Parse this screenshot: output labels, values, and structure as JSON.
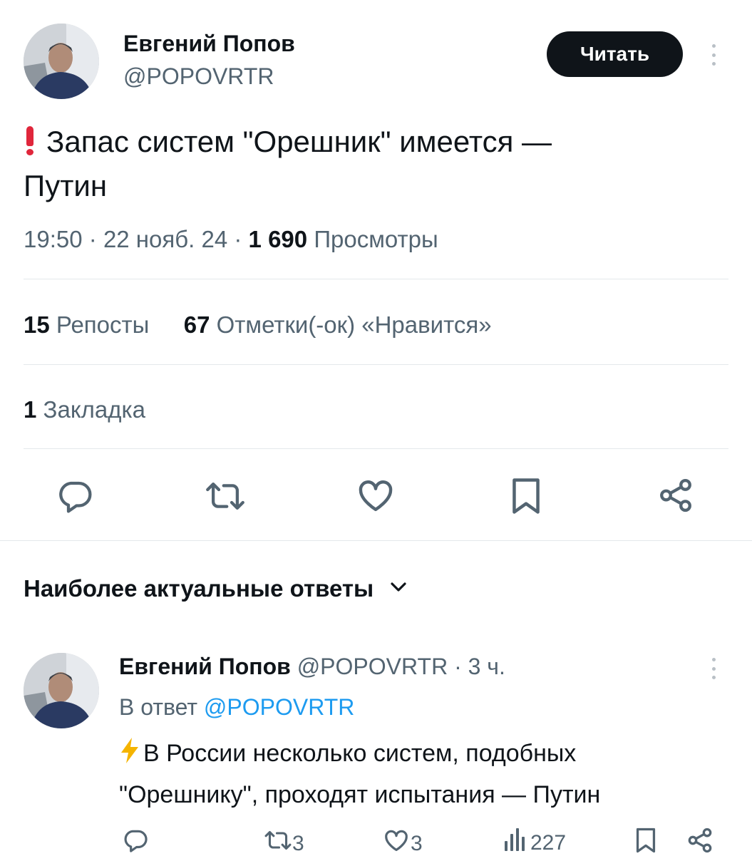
{
  "tweet": {
    "author_name": "Евгений Попов",
    "author_handle": "@POPOVRTR",
    "follow_label": "Читать",
    "text_line1": "Запас систем \"Орешник\" имеется —",
    "text_line2": "Путин",
    "time": "19:50",
    "date": "22 нояб. 24",
    "views_count": "1 690",
    "views_label": "Просмотры",
    "reposts_count": "15",
    "reposts_label": "Репосты",
    "likes_count": "67",
    "likes_label": "Отметки(-ок) «Нравится»",
    "bookmarks_count": "1",
    "bookmarks_label": "Закладка",
    "sep": "·"
  },
  "replies_header": {
    "label": "Наиболее актуальные ответы"
  },
  "reply": {
    "author_name": "Евгений Попов",
    "author_handle": "@POPOVRTR",
    "sep": "·",
    "time_ago": "3 ч.",
    "in_reply_prefix": "В ответ",
    "in_reply_handle": "@POPOVRTR",
    "text_line1": "В России несколько систем, подобных",
    "text_line2": "\"Орешнику\", проходят испытания — Путин",
    "retweets": "3",
    "likes": "3",
    "views": "227"
  },
  "colors": {
    "text": "#0f1419",
    "muted": "#536471",
    "link": "#1d9bf0",
    "divider": "#e4e8eb",
    "button_bg": "#0f1419"
  },
  "icons": [
    "kebab-icon",
    "exclamation-icon",
    "reply-icon",
    "retweet-icon",
    "like-icon",
    "bookmark-icon",
    "share-icon",
    "chevron-down-icon",
    "lightning-icon",
    "views-icon"
  ]
}
